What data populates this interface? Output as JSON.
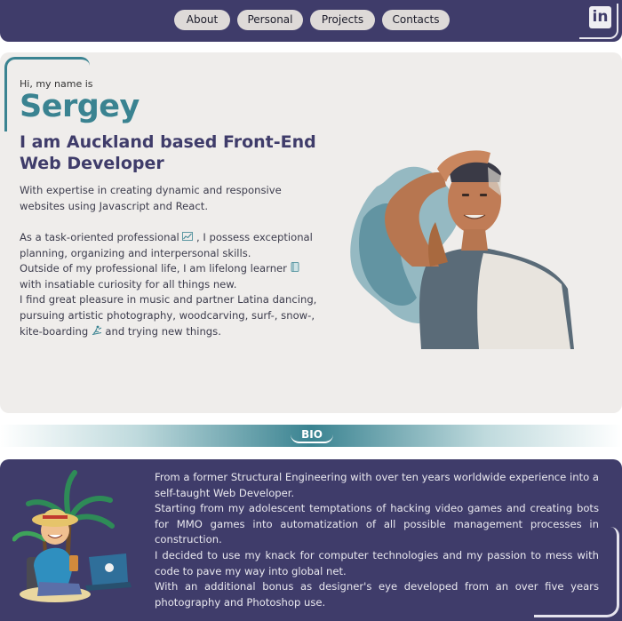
{
  "nav": {
    "links": [
      "About",
      "Personal",
      "Projects",
      "Contacts"
    ],
    "linkedin_icon": "linkedin-icon",
    "linkedin_glyph": "in"
  },
  "hero": {
    "greeting": "Hi, my name is",
    "name": "Sergey",
    "headline": "I am Auckland based Front-End Web Developer",
    "intro": "With expertise in creating dynamic and responsive websites using Javascript and React.",
    "about": {
      "p1_a": "As a task-oriented professional",
      "p1_b": ", I possess exceptional planning, organizing and interpersonal skills.",
      "p2_a": "Outside of my professional life, I am lifelong learner",
      "p2_b": "with insatiable curiosity for all things new.",
      "p3_a": "I find great pleasure in music and partner Latina dancing, pursuing artistic photography, woodcarving, surf-, snow-, kite-boarding",
      "p3_b": "and trying new things."
    },
    "icons": {
      "chart": "chart-icon",
      "book": "book-icon",
      "kite": "kite-surfer-icon"
    }
  },
  "bio": {
    "label": "BIO",
    "paragraphs": [
      "From a former Structural Engineering with over ten years worldwide experience into a self-taught Web Developer.",
      "Starting from my adolescent temptations of hacking video games and creating bots for MMO games into automatization of all possible management processes in construction.",
      "I decided to use my knack for computer technologies and my passion to mess with code to pave my way into global net.",
      "With an additional bonus as designer's eye developed from an over five years photography and Photoshop use."
    ]
  },
  "colors": {
    "nav_bg": "#3f3c6a",
    "accent_teal": "#3a8391",
    "hero_bg": "#efedeb",
    "button_bg": "#dedad8"
  }
}
